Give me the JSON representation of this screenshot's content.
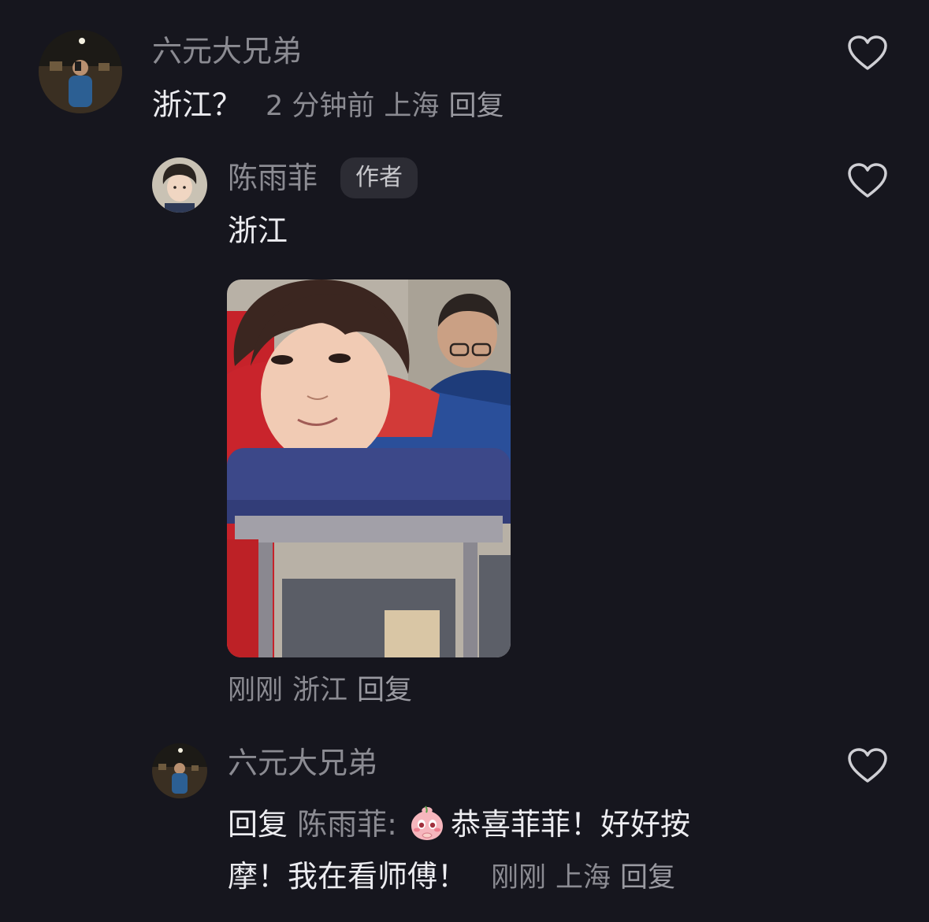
{
  "comments": [
    {
      "username": "六元大兄弟",
      "text": "浙江？",
      "time": "2 分钟前",
      "location": "上海",
      "reply_label": "回复"
    },
    {
      "username": "陈雨菲",
      "badge": "作者",
      "text": "浙江",
      "time": "刚刚",
      "location": "浙江",
      "reply_label": "回复"
    },
    {
      "username": "六元大兄弟",
      "reply_prefix": "回复",
      "reply_to": "陈雨菲:",
      "text_line1": "恭喜菲菲！好好按",
      "text_line2": "摩！我在看师傅！",
      "time": "刚刚",
      "location": "上海",
      "reply_label": "回复"
    }
  ],
  "icons": {
    "like": "heart-outline-icon",
    "emoji": "shy-peach-emoji"
  },
  "colors": {
    "background": "#16161e",
    "text_primary": "#ececf0",
    "text_secondary": "#8b8b92",
    "badge_bg": "#2c2c34"
  }
}
